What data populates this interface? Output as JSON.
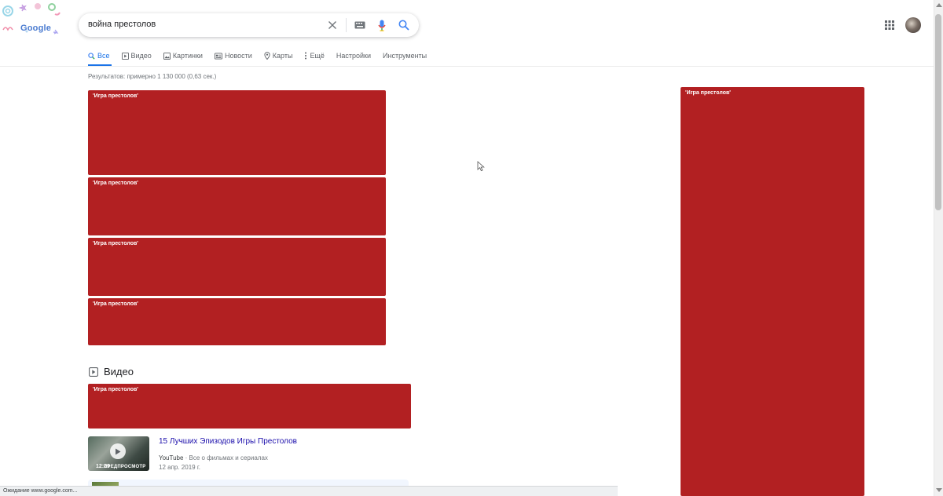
{
  "logo": {
    "text": "Google"
  },
  "search": {
    "value": "война престолов"
  },
  "search_icons": {
    "clear": "close-icon",
    "keyboard": "keyboard-icon",
    "voice": "mic-icon",
    "submit": "search-icon"
  },
  "tabs": [
    {
      "label": "Все",
      "icon": "search-icon",
      "active": true
    },
    {
      "label": "Видео",
      "icon": "video-icon"
    },
    {
      "label": "Картинки",
      "icon": "image-icon"
    },
    {
      "label": "Новости",
      "icon": "news-icon"
    },
    {
      "label": "Карты",
      "icon": "map-pin-icon"
    },
    {
      "label": "Ещё",
      "icon": "more-vert-icon"
    },
    {
      "label": "Настройки"
    },
    {
      "label": "Инструменты"
    }
  ],
  "result_stats": "Результатов: примерно 1 130 000 (0,63 сек.)",
  "blocked_label": "'Игра престолов'",
  "video_section": {
    "heading": "Видео",
    "items": [
      {
        "title": "15 Лучших Эпизодов Игры Престолов",
        "source": "YouTube",
        "source_suffix": " · Все о фильмах и сериалах",
        "date": "12 апр. 2019 г.",
        "duration": "12:29",
        "preview": "ПРЕДПРОСМОТР"
      }
    ]
  },
  "status_bar": {
    "text": "Ожидание www.google.com..."
  },
  "colors": {
    "accent": "#1a73e8",
    "link": "#1a0dab",
    "blocked": "#b22022"
  }
}
